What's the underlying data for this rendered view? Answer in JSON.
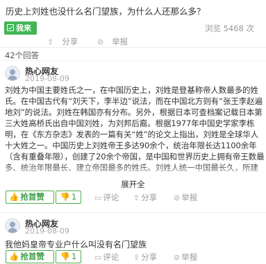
{
  "question": {
    "title": "历史上刘姓也没什么名门望族，为什么人还那么多？",
    "answer_button": "我来",
    "views": "浏览 5468 次",
    "share_label": "分享",
    "report_label": "举报"
  },
  "answers_count": "42个回答",
  "answers": [
    {
      "user": "热心网友",
      "date": "2019-08-09",
      "text": "刘姓为中国主要姓氏之一，在中国历史上，刘姓是登基称帝人数最多的姓氏。在中国古代有“刘天下，李半边”说法，而在中国北方则有“张王李赵遍地刘”的说法。刘姓在韩国亦有分布。另外，根据日本可查档案记载日本第三大姓高桥氏出自中国刘姓，为刘邦后裔。根据1977年中国史学家李栋明，在《东方杂志》发表的一篇有关“姓”的论文上指出，刘姓是全球华人十大姓之一。中国历史上刘姓帝王多达90余个，统治年限长达1100余年（含有重叠年限），创建了20余个帝国，是中国和世界历史上拥有帝王数最多、统治年限最长、建立帝国最多的姓氏。刘姓人统一中国最长久，所建立的汉朝是中国历史上最长的封建王朝和最长的统一王朝，长达",
      "expand_label": "展开全",
      "like_label": "抢首赞",
      "dislike_count": "1",
      "comment_label": "评论",
      "share_label": "分享",
      "report_label": "举报"
    },
    {
      "user": "热心网友",
      "date": "2019-08-09",
      "text": "我他妈皇帝专业户什么叫没有名门望族",
      "like_label": "抢首赞",
      "dislike_count": "1",
      "comment_label": "评论",
      "share_label": "分享",
      "report_label": "举报"
    }
  ],
  "colors": {
    "accent": "#42b557",
    "muted": "#999999"
  },
  "icons": [
    "check-square-icon",
    "share-icon",
    "report-icon",
    "user-avatar-icon",
    "thumb-up-icon",
    "thumb-down-icon",
    "comment-icon"
  ]
}
